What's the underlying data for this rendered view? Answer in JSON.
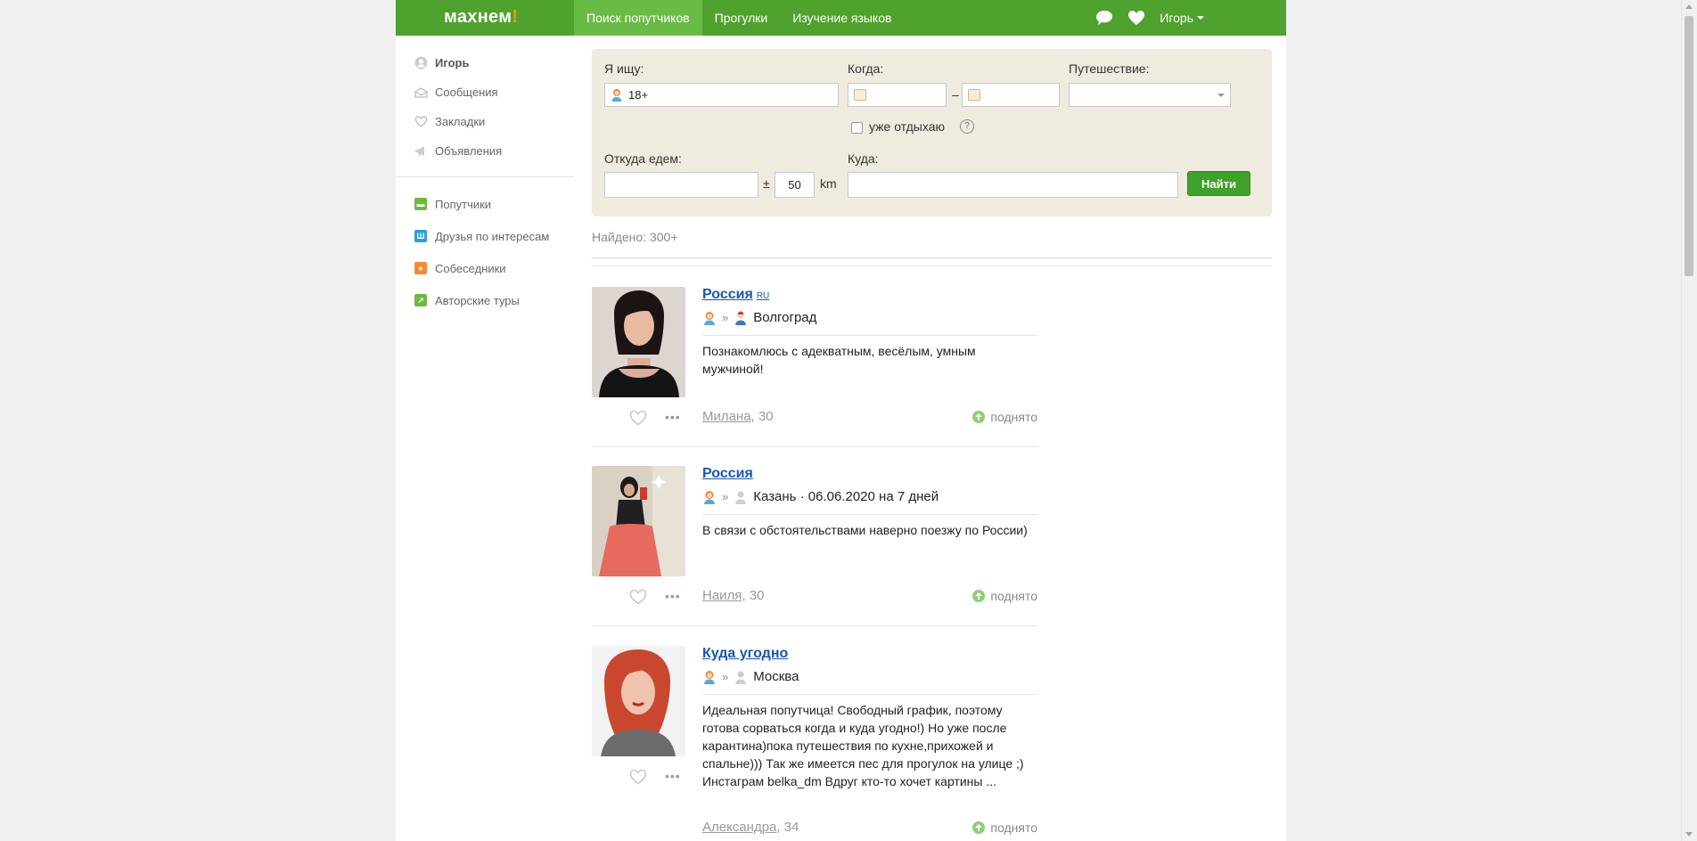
{
  "brand": {
    "logo": "махнем",
    "logo_mark": "!"
  },
  "nav": {
    "items": [
      {
        "label": "Поиск попутчиков",
        "active": true
      },
      {
        "label": "Прогулки",
        "active": false
      },
      {
        "label": "Изучение языков",
        "active": false
      }
    ],
    "user_name": "Игорь"
  },
  "sidebar": {
    "top": [
      {
        "label": "Игорь",
        "icon": "user-icon"
      },
      {
        "label": "Сообщения",
        "icon": "envelope-icon"
      },
      {
        "label": "Закладки",
        "icon": "heart-icon"
      },
      {
        "label": "Объявления",
        "icon": "megaphone-icon"
      }
    ],
    "bottom": [
      {
        "label": "Попутчики",
        "icon": "suitcase-icon",
        "color": "#6cbb3c"
      },
      {
        "label": "Друзья по интересам",
        "icon": "bank-icon",
        "color": "#2a9fd8"
      },
      {
        "label": "Собеседники",
        "icon": "chat-icon",
        "color": "#f28c35"
      },
      {
        "label": "Авторские туры",
        "icon": "leaf-icon",
        "color": "#6cbb3c"
      }
    ]
  },
  "search": {
    "looking_label": "Я ищу:",
    "looking_value": "18+",
    "when_label": "Когда:",
    "dash": "–",
    "trip_label": "Путешествие:",
    "already_label": "уже отдыхаю",
    "help": "?",
    "from_label": "Откуда едем:",
    "plusminus": "±",
    "radius": "50",
    "unit": "km",
    "to_label": "Куда:",
    "button": "Найти"
  },
  "found_text": "Найдено: 300+",
  "results": [
    {
      "title": "Россия",
      "country_code": "RU",
      "route_sep": "»",
      "city": "Волгоград",
      "description": "Познакомлюсь с адекватным, весёлым, умным мужчиной!",
      "name": "Милана",
      "age": ", 30",
      "raised": "поднято"
    },
    {
      "title": "Россия",
      "country_code": "",
      "route_sep": "»",
      "city": "Казань · 06.06.2020 на 7 дней",
      "description": "В связи с обстоятельствами наверно поезжу по России)",
      "name": "Наиля",
      "age": ", 30",
      "raised": "поднято"
    },
    {
      "title": "Куда угодно",
      "country_code": "",
      "route_sep": "»",
      "city": "Москва",
      "description": "Идеальная попутчица! Свободный график, поэтому готова сорваться когда и куда угодно!) Но уже после карантина)пока путешествия по кухне,прихожей и спальне))) Так же имеется пес для прогулок на улице ;) Инстаграм belka_dm Вдруг кто-то хочет картины ...",
      "name": "Александра",
      "age": ", 34",
      "raised": "поднято"
    }
  ]
}
